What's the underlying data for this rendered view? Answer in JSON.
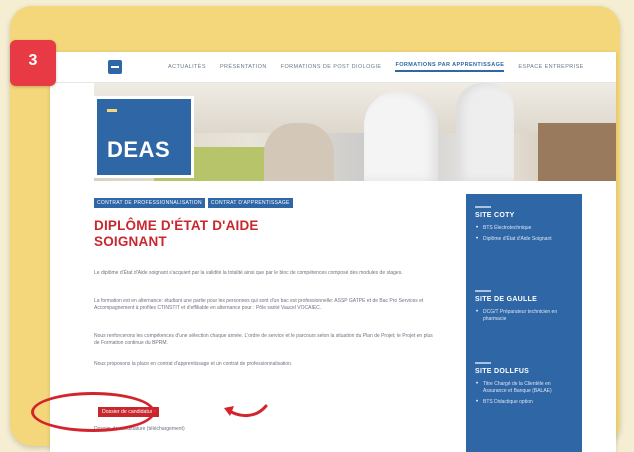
{
  "step": {
    "number": "3",
    "color": "#e73a44"
  },
  "nav": {
    "items": [
      "ACTUALITÉS",
      "PRÉSENTATION",
      "FORMATIONS DE POST DIOLOGIE",
      "FORMATIONS PAR APPRENTISSAGE",
      "ESPACE ENTREPRISE"
    ],
    "active_index": 3
  },
  "hero": {
    "badge": "DEAS"
  },
  "breadcrumbs": [
    "CONTRAT DE PROFESSIONNALISATION",
    "CONTRAT D'APPRENTISSAGE"
  ],
  "main": {
    "title": "DIPLÔME D'ÉTAT D'AIDE SOIGNANT",
    "paragraphs": [
      "Le diplôme d'État d'Aide soignant s'acquiert par la validité la totalité ainsi que par le bloc de compétences composé des modules de stages.",
      "La formation est en alternance: étudiant une partie pour les personnes qui sont d'un bac est professionnelle: ASSP GATPE et de Bac Pro Services et Accompagnement à profiles CTINSTIT et d'effiliable en alternance pour : Pôle santé Vaucel VOCAIEC.",
      "Nous renforcerons les compétences d'une sélection chaque année. L'ordre de service et le parcours selon la situation du Plan de Projet; le Projet en plus de Formation continue du BPRM.",
      "Nous proposons la place en contrat d'apprentissage et un contrat de professionnalisation."
    ],
    "cta_button": "Dossier de candidature",
    "last_line": "Dossier de candidature (téléchargement)"
  },
  "sidebar": {
    "sections": [
      {
        "title": "SITE COTY",
        "items": [
          "BTS Électrotechnique",
          "Diplôme d'État d'Aide Soignant"
        ]
      },
      {
        "title": "SITE DE GAULLE",
        "items": [
          "DCG/T Préparateur technicien en pharmacie"
        ]
      },
      {
        "title": "SITE DOLLFUS",
        "items": [
          "Titre Chargé de la Clientèle en Assurance et Banque (BALAE)",
          "BTS Didactique option"
        ]
      }
    ]
  },
  "colors": {
    "brand_blue": "#2f66a6",
    "accent_red": "#c8272e",
    "frame_yellow": "#f3d77a"
  }
}
